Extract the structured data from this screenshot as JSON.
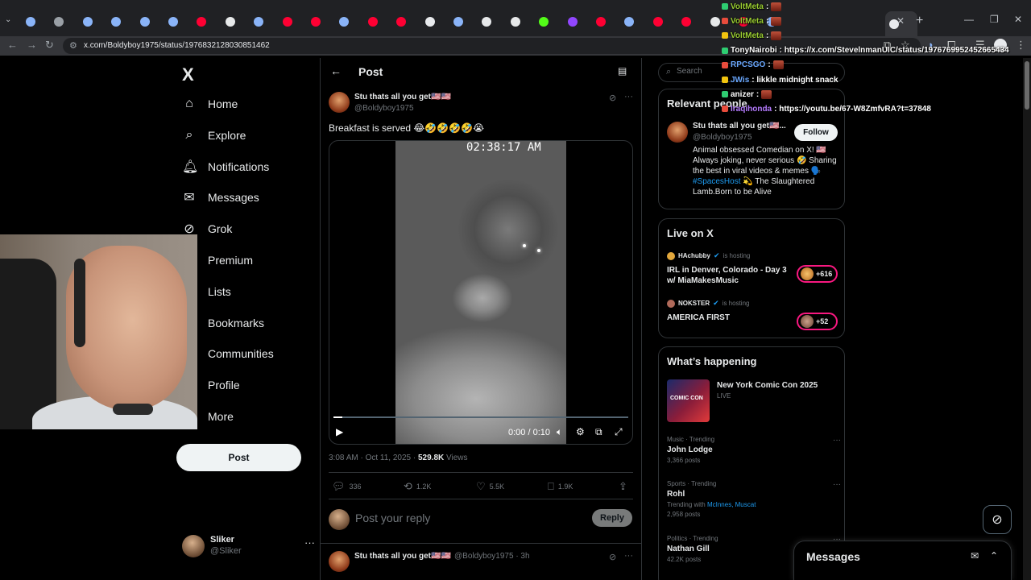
{
  "browser": {
    "url": "x.com/Boldyboy1975/status/1976832128030851462",
    "tab_close": "✕",
    "new_tab": "+",
    "tab_list": "⌄",
    "tab_favicons": [
      "#8ab4f8",
      "#9aa0a6",
      "#8ab4f8",
      "#8ab4f8",
      "#8ab4f8",
      "#8ab4f8",
      "#ff0033",
      "#e7e9ea",
      "#8ab4f8",
      "#ff0033",
      "#ff0033",
      "#8ab4f8",
      "#ff0033",
      "#ff0033",
      "#e8eaed",
      "#8ab4f8",
      "#e7e9ea",
      "#e7e9ea",
      "#53fc18",
      "#9146ff",
      "#ff0033",
      "#8ab4f8",
      "#ff0033",
      "#ff0033",
      "#e7e9ea",
      "#ff0033",
      "#8ab4f8"
    ]
  },
  "sidebar": {
    "logo": "X",
    "items": [
      {
        "label": "Home",
        "icon": "home-icon"
      },
      {
        "label": "Explore",
        "icon": "search-icon"
      },
      {
        "label": "Notifications",
        "icon": "bell-icon"
      },
      {
        "label": "Messages",
        "icon": "envelope-icon"
      },
      {
        "label": "Grok",
        "icon": "grok-icon"
      },
      {
        "label": "Premium",
        "icon": "x-premium-icon"
      },
      {
        "label": "Lists",
        "icon": "list-icon"
      },
      {
        "label": "Bookmarks",
        "icon": "bookmark-icon"
      },
      {
        "label": "Communities",
        "icon": "people-icon"
      },
      {
        "label": "Profile",
        "icon": "person-icon"
      },
      {
        "label": "More",
        "icon": "more-circle-icon"
      }
    ],
    "post_button": "Post",
    "account": {
      "name": "Sliker",
      "handle": "@Sliker"
    }
  },
  "main": {
    "header_title": "Post",
    "post": {
      "author_name": "Stu thats all you get🇺🇸🇺🇸",
      "author_handle": "@Boldyboy1975",
      "text": "Breakfast is served 😂🤣🤣🤣🤣😭",
      "video": {
        "overlay_timestamp": "02:38:17 AM",
        "time": "0:00 / 0:10",
        "progress": 0.03
      },
      "meta_time": "3:08 AM · Oct 11, 2025 · ",
      "views_count": "529.8K",
      "views_label": " Views",
      "replies": "336",
      "reposts": "1.2K",
      "likes": "5.5K",
      "bookmarks": "1.9K"
    },
    "reply_placeholder": "Post your reply",
    "reply_button": "Reply",
    "next_reply": {
      "author_name": "Stu thats all you get🇺🇸🇺🇸",
      "author_handle": "@Boldyboy1975 · 3h"
    }
  },
  "right": {
    "search_placeholder": "Search",
    "relevant": {
      "title": "Relevant people",
      "name": "Stu thats all you get🇺🇸...",
      "handle": "@Boldyboy1975",
      "follow": "Follow",
      "bio_1": "Animal obsessed Comedian on X! 🇺🇸 Always joking, never serious 🤣 Sharing the best in viral videos & memes 🗣️",
      "bio_tag": "#SpacesHost",
      "bio_2": " 💫 The Slaughtered Lamb.Born to be Alive"
    },
    "live": {
      "title": "Live on X",
      "items": [
        {
          "host": "HAchubby",
          "status": "is hosting",
          "title": "IRL in Denver, Colorado - Day 3 w/ MiaMakesMusic",
          "count": "+616"
        },
        {
          "host": "NOKSTER",
          "status": "is hosting",
          "title": "AMERICA FIRST",
          "count": "+52"
        }
      ]
    },
    "happening": {
      "title": "What’s happening",
      "featured": {
        "title": "New York Comic Con 2025",
        "status": "LIVE",
        "image_text": "COMIC CON"
      },
      "trends": [
        {
          "category": "Music · Trending",
          "name": "John Lodge",
          "count": "3,366 posts"
        },
        {
          "category": "Sports · Trending",
          "name": "Rohl",
          "with_label": "Trending with ",
          "with_names": "McInnes, Muscat",
          "count": "2,958 posts"
        },
        {
          "category": "Politics · Trending",
          "name": "Nathan Gill",
          "count": "42.2K posts"
        }
      ]
    },
    "messages_dock": "Messages"
  },
  "chat": [
    {
      "user": "VoltMeta",
      "text": ":",
      "color": "#9acd32"
    },
    {
      "user": "VoltMeta",
      "text": ":",
      "color": "#9acd32"
    },
    {
      "user": "VoltMeta",
      "text": ":",
      "color": "#9acd32"
    },
    {
      "user": "TonyNairobi",
      "text": ": https://x.com/StevelnmanUIC/status/1976769952452665434",
      "color": "#ffffff"
    },
    {
      "user": "RPCSGO",
      "text": ":",
      "color": "#6aa8ff"
    },
    {
      "user": "JWis",
      "text": ": likkle midnight snack",
      "color": "#6aa8ff"
    },
    {
      "user": "anizer",
      "text": ":",
      "color": "#ffffff"
    },
    {
      "user": "Iraqihonda",
      "text": ": https://youtu.be/67-W8ZmfvRA?t=37848",
      "color": "#b57bff"
    }
  ]
}
